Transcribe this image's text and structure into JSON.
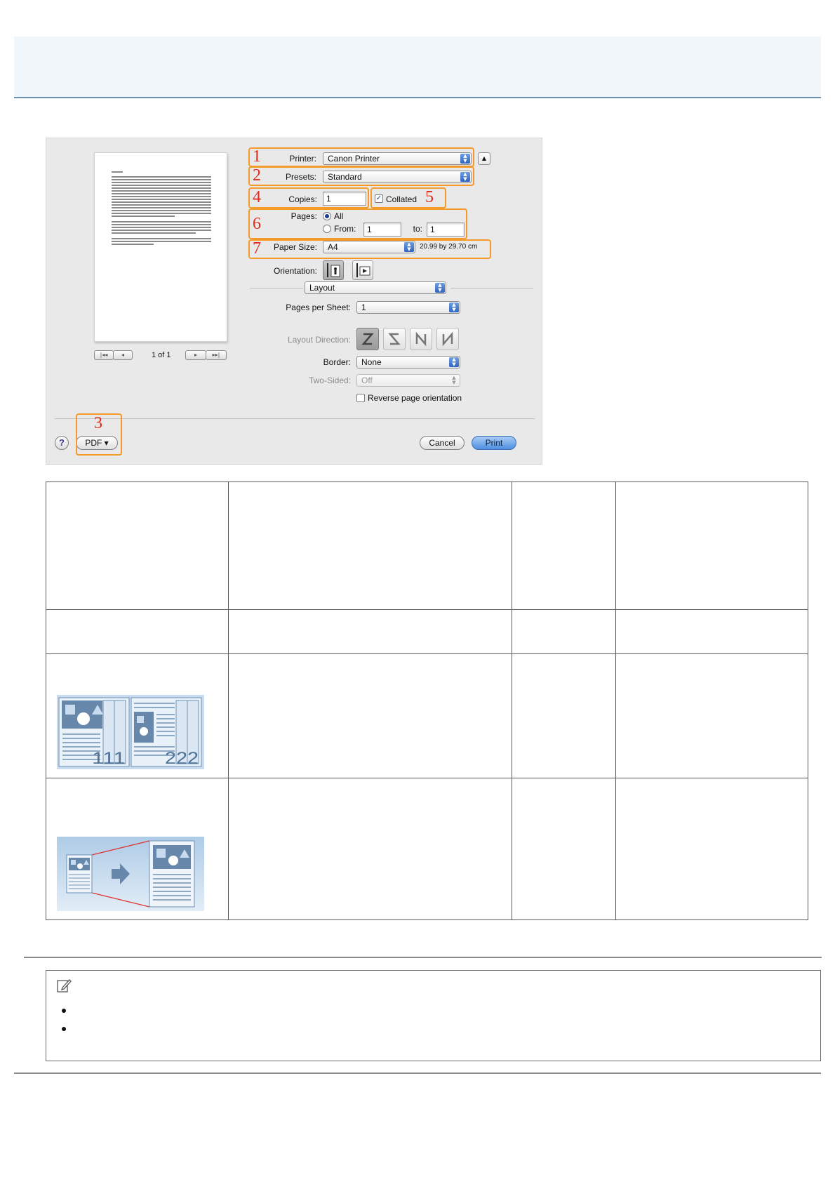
{
  "dialog": {
    "preview": {
      "page_count": "1 of 1"
    },
    "printer": {
      "label": "Printer:",
      "value": "Canon Printer"
    },
    "presets": {
      "label": "Presets:",
      "value": "Standard"
    },
    "copies": {
      "label": "Copies:",
      "value": "1",
      "collated_label": "Collated",
      "collated": true
    },
    "pages": {
      "label": "Pages:",
      "all_label": "All",
      "from_label": "From:",
      "from_value": "1",
      "to_label": "to:",
      "to_value": "1"
    },
    "paper_size": {
      "label": "Paper Size:",
      "value": "A4",
      "dimensions": "20.99 by 29.70 cm"
    },
    "orientation": {
      "label": "Orientation:"
    },
    "section": {
      "value": "Layout"
    },
    "pages_per_sheet": {
      "label": "Pages per Sheet:",
      "value": "1"
    },
    "layout_direction": {
      "label": "Layout Direction:"
    },
    "border": {
      "label": "Border:",
      "value": "None"
    },
    "two_sided": {
      "label": "Two-Sided:",
      "value": "Off"
    },
    "reverse": {
      "label": "Reverse page orientation"
    },
    "pdf_button": "PDF ▾",
    "cancel_button": "Cancel",
    "print_button": "Print",
    "help_button": "?",
    "callouts": [
      "1",
      "2",
      "3",
      "4",
      "5",
      "6",
      "7"
    ]
  },
  "illustrations": {
    "collate_page_numbers_1": "111",
    "collate_page_numbers_2": "222"
  }
}
